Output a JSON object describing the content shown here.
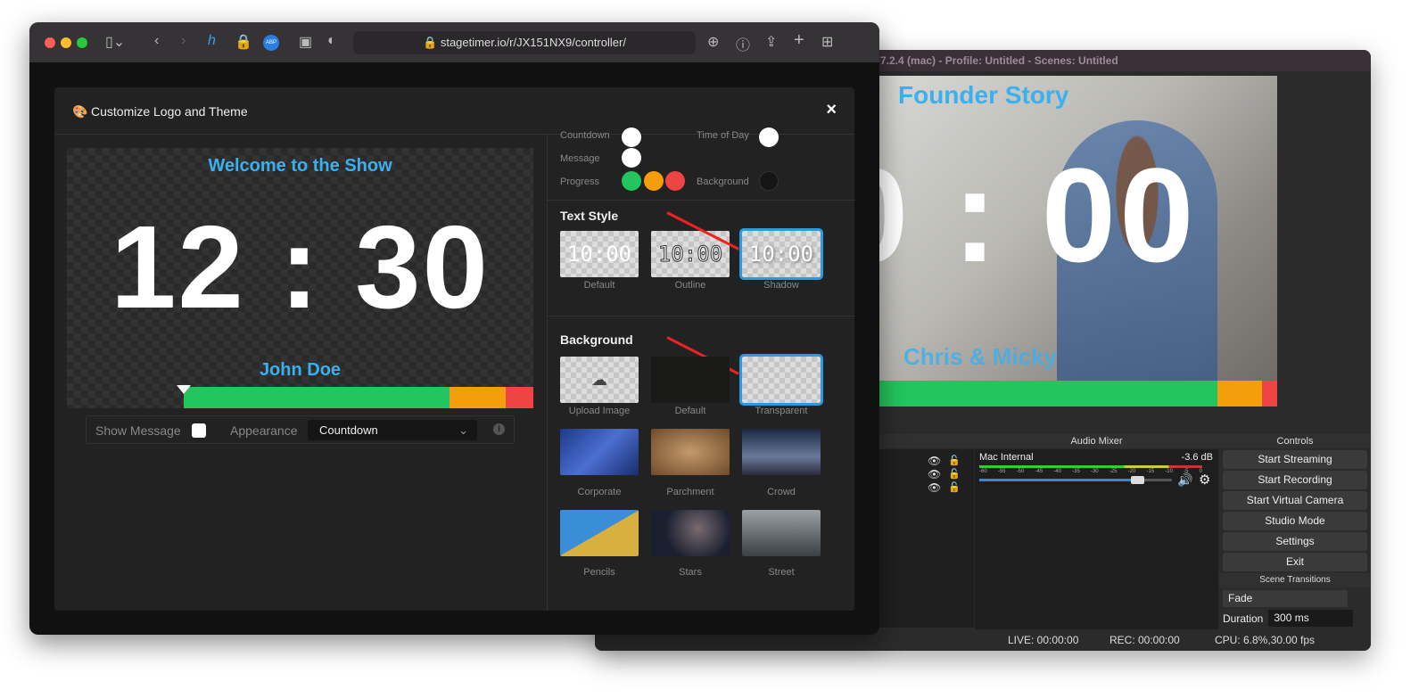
{
  "browser": {
    "url": "stagetimer.io/r/JX151NX9/controller/"
  },
  "modal": {
    "title": "Customize Logo and Theme",
    "close": "×",
    "preview": {
      "title": "Welcome to the Show",
      "time": "12 : 30",
      "name": "John Doe",
      "progress_elapsed": 0.25,
      "colors": {
        "green": "#22c55e",
        "orange": "#f59e0b",
        "red": "#ef4444"
      }
    },
    "options": {
      "show_message_label": "Show Message",
      "show_message_checked": false,
      "appearance_label": "Appearance",
      "appearance_value": "Countdown"
    },
    "colors": {
      "countdown": "Countdown",
      "time_of_day": "Time of Day",
      "message": "Message",
      "progress": "Progress",
      "background": "Background"
    },
    "text_style": {
      "heading": "Text Style",
      "sample": "10:00",
      "items": [
        "Default",
        "Outline",
        "Shadow"
      ],
      "selected": "Shadow"
    },
    "background": {
      "heading": "Background",
      "items": [
        "Upload Image",
        "Default",
        "Transparent",
        "Corporate",
        "Parchment",
        "Crowd",
        "Pencils",
        "Stars",
        "Street"
      ],
      "selected": "Transparent"
    }
  },
  "obs": {
    "title": "7.2.4 (mac) - Profile: Untitled - Scenes: Untitled",
    "preview": {
      "title": "Founder Story",
      "time": "0 : 00",
      "name": "Chris & Micky"
    },
    "docks": {
      "audio_mixer": "Audio Mixer",
      "controls": "Controls",
      "scene_transitions": "Scene Transitions"
    },
    "mixer": {
      "source": "Mac Internal",
      "level": "-3.6 dB",
      "ticks": [
        "-60",
        "-55",
        "-50",
        "-45",
        "-40",
        "-35",
        "-30",
        "-25",
        "-20",
        "-15",
        "-10",
        "-5",
        "0"
      ],
      "volume": 0.8
    },
    "controls": [
      "Start Streaming",
      "Start Recording",
      "Start Virtual Camera",
      "Studio Mode",
      "Settings",
      "Exit"
    ],
    "transition": {
      "value": "Fade",
      "duration_label": "Duration",
      "duration": "300 ms"
    },
    "status": {
      "live": "LIVE: 00:00:00",
      "rec": "REC: 00:00:00",
      "cpu": "CPU: 6.8%,30.00 fps"
    }
  }
}
